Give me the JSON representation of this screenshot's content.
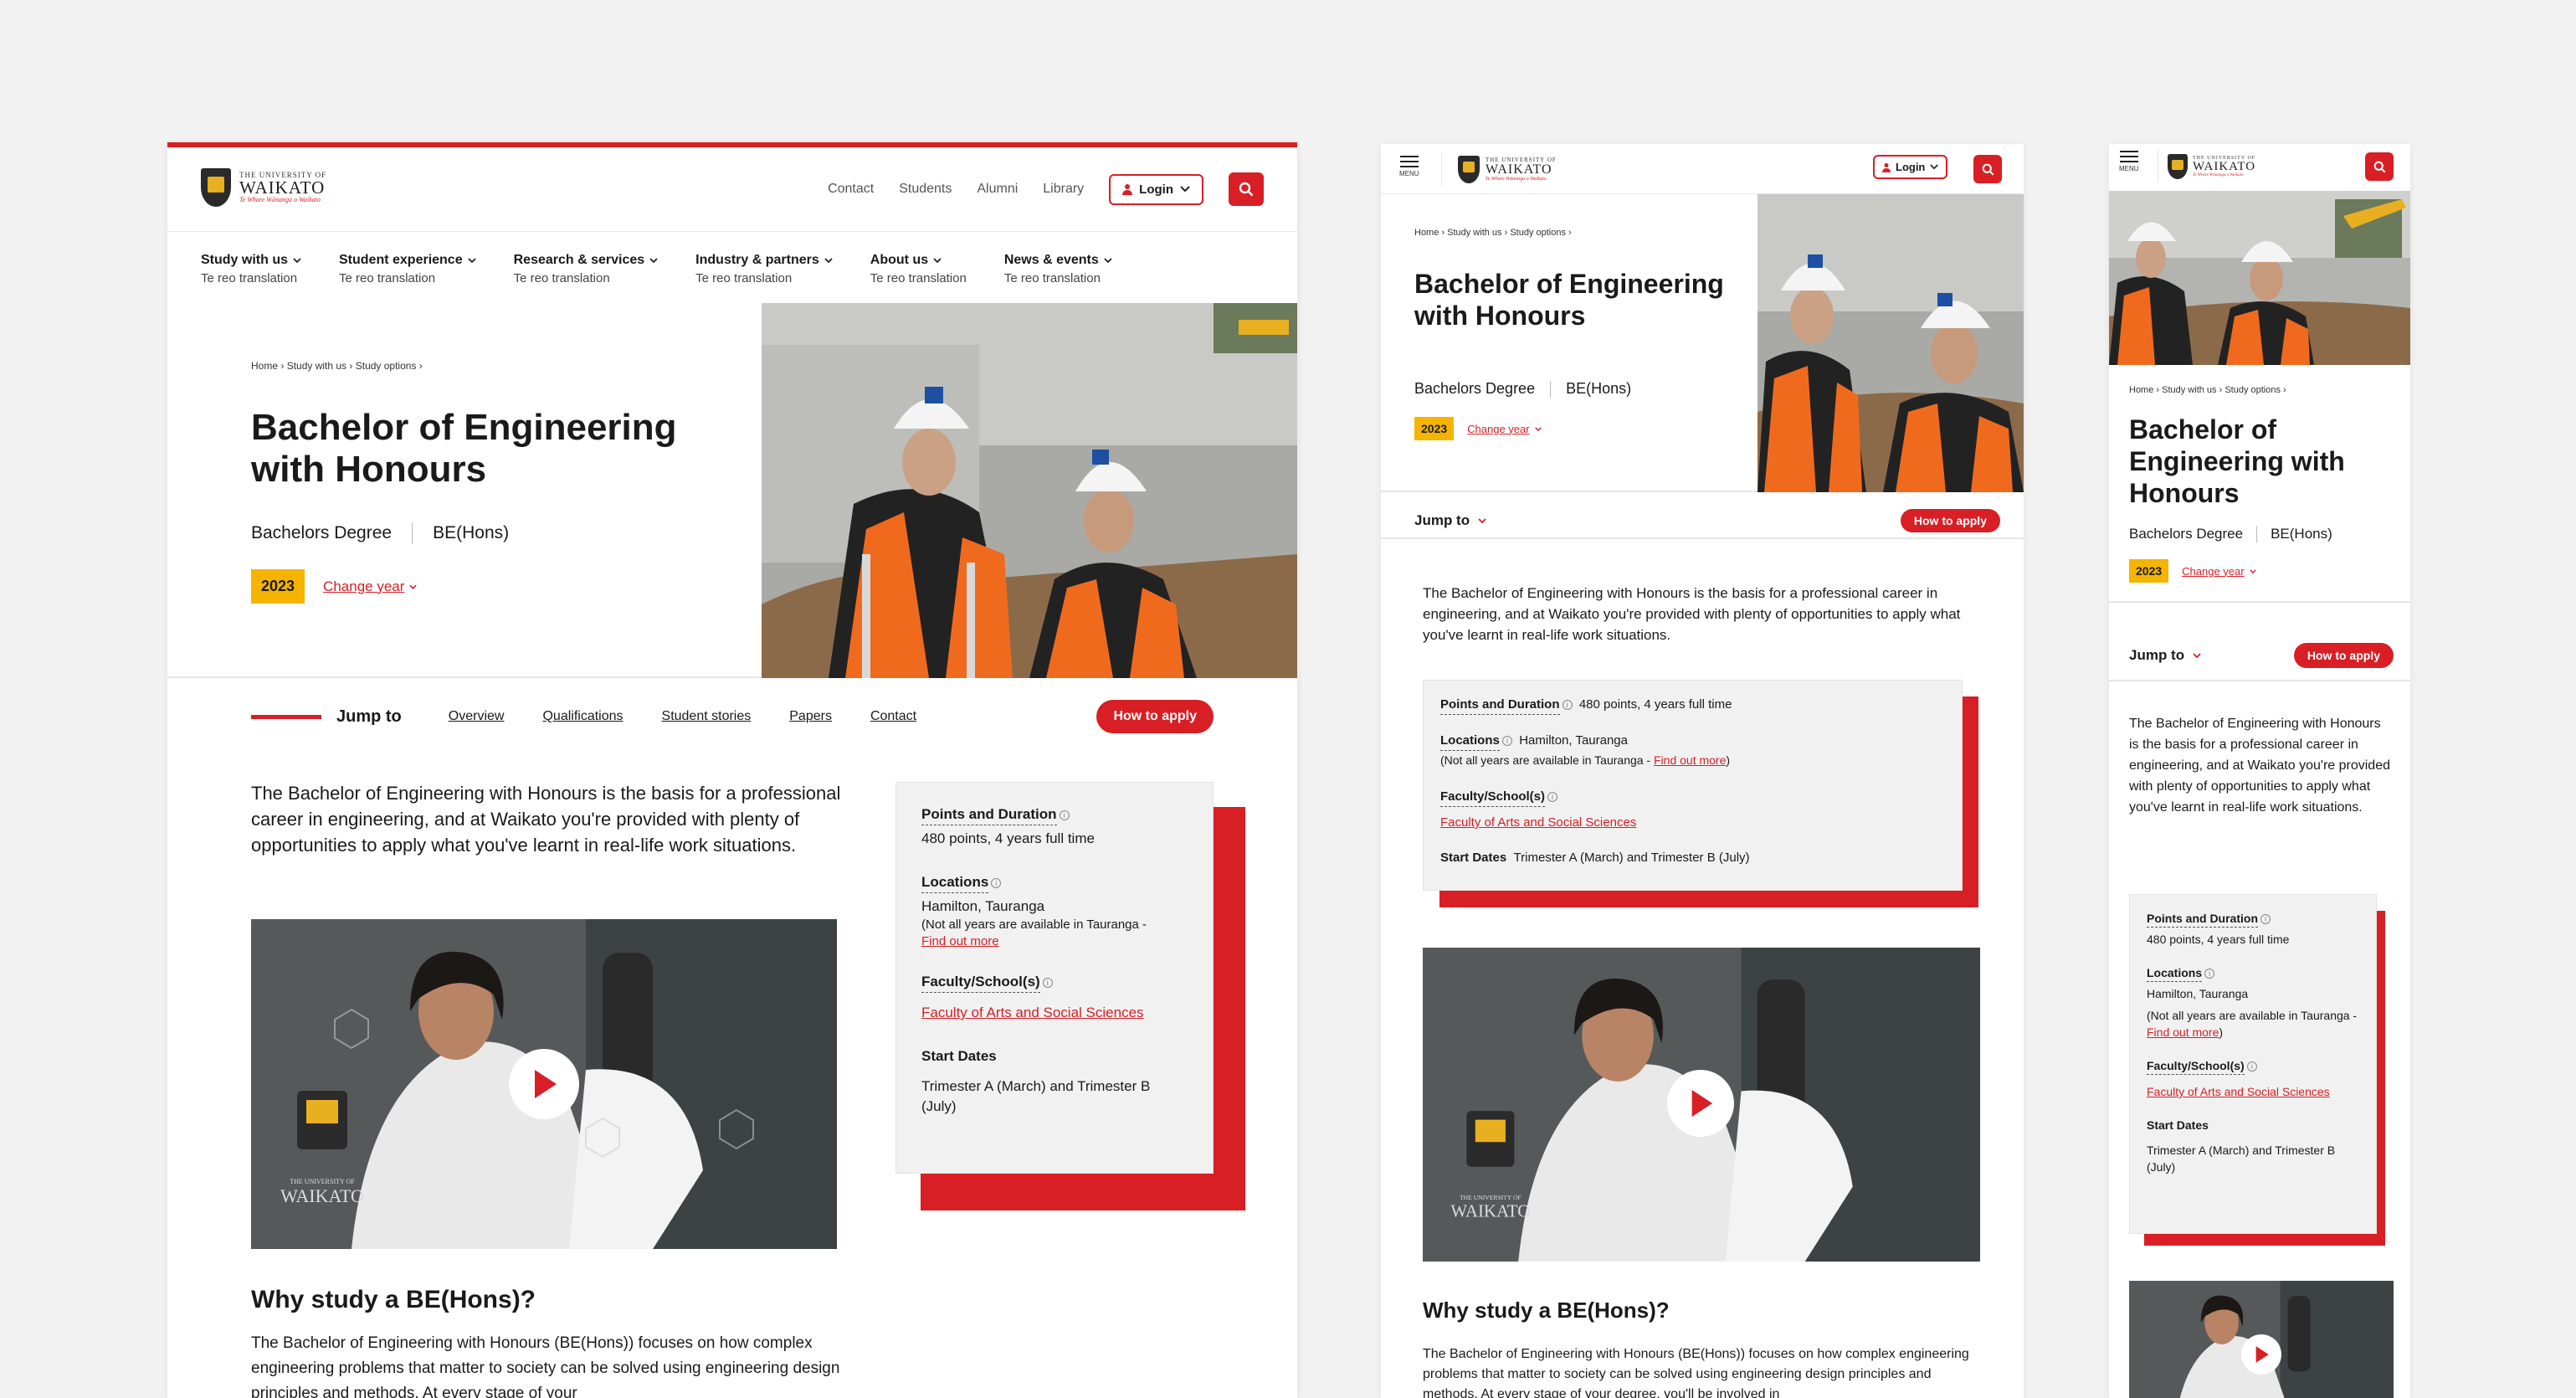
{
  "brand": {
    "line1": "THE UNIVERSITY OF",
    "line2": "WAIKATO",
    "line3": "Te Whare Wānanga o Waikato"
  },
  "utility": {
    "contact": "Contact",
    "students": "Students",
    "alumni": "Alumni",
    "library": "Library",
    "login": "Login",
    "menu": "MENU"
  },
  "nav": [
    {
      "title": "Study with us",
      "sub": "Te reo translation"
    },
    {
      "title": "Student experience",
      "sub": "Te reo translation"
    },
    {
      "title": "Research & services",
      "sub": "Te reo translation"
    },
    {
      "title": "Industry & partners",
      "sub": "Te reo translation"
    },
    {
      "title": "About us",
      "sub": "Te reo translation"
    },
    {
      "title": "News & events",
      "sub": "Te reo translation"
    }
  ],
  "breadcrumbs": [
    "Home",
    "Study with us",
    "Study options"
  ],
  "page": {
    "title": "Bachelor of Engineering with Honours",
    "degree_type": "Bachelors Degree",
    "degree_abbr": "BE(Hons)",
    "year": "2023",
    "change_year": "Change year"
  },
  "jump": {
    "label": "Jump to",
    "links": [
      "Overview",
      "Qualifications",
      "Student stories",
      "Papers",
      "Contact"
    ],
    "apply": "How to apply"
  },
  "intro": "The Bachelor of Engineering with Honours is the basis for a professional career in engineering, and at Waikato you're provided with plenty of opportunities to apply what you've learnt in real-life work situations.",
  "facts": {
    "points_label": "Points and Duration",
    "points_value": "480 points, 4 years full time",
    "locations_label": "Locations",
    "locations_value": "Hamilton, Tauranga",
    "locations_note": "(Not all years are available in Tauranga -",
    "locations_note_dash": "(Not all years are available in Tauranga - ",
    "find_out": "Find out more",
    "close_paren": ")",
    "faculty_label": "Faculty/School(s)",
    "faculty_value": "Faculty of Arts and Social Sciences",
    "start_label": "Start Dates",
    "start_value": "Trimester A (March) and Trimester B (July)"
  },
  "video": {
    "logo_line1": "THE UNIVERSITY OF",
    "logo_line2": "WAIKATO"
  },
  "why": {
    "heading": "Why study a BE(Hons)?",
    "body_desktop": "The Bachelor of Engineering with Honours (BE(Hons)) focuses on how complex engineering problems that matter to society can be solved using engineering design principles and methods. At every stage of your",
    "body_tablet": "The Bachelor of Engineering with Honours (BE(Hons)) focuses on how complex engineering problems that matter to society can be solved using engineering design principles and methods. At every stage of your degree, you'll be involved in"
  },
  "colors": {
    "accent": "#d71f25",
    "year_badge": "#f5b400",
    "fact_bg": "#f1f1f1"
  }
}
